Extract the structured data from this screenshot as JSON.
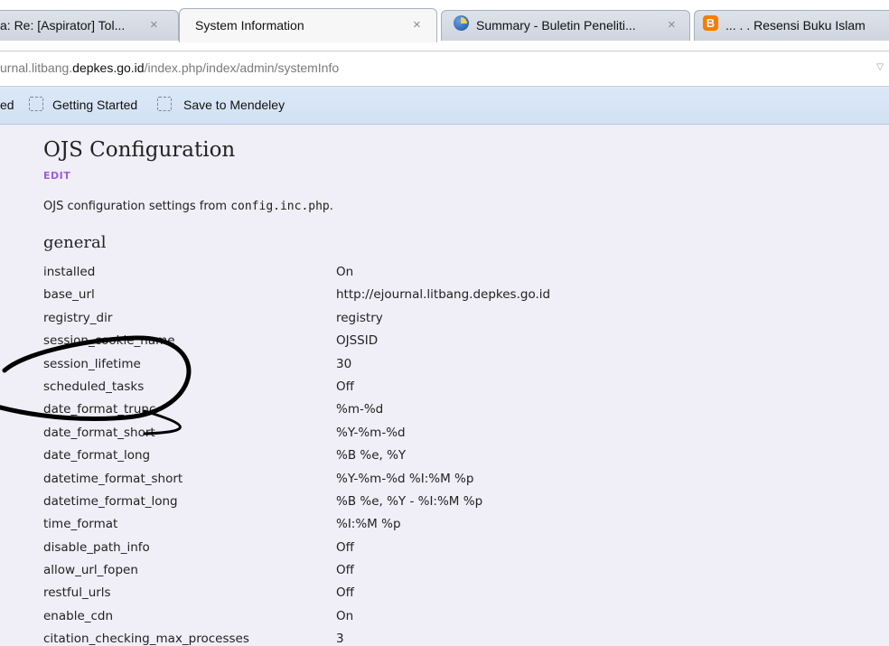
{
  "browser": {
    "tabs": [
      {
        "label": "a: Re: [Aspirator] Tol...",
        "active": false,
        "icon": "none"
      },
      {
        "label": "System Information",
        "active": true,
        "icon": "none"
      },
      {
        "label": "Summary - Buletin Peneliti...",
        "active": false,
        "icon": "report-icon"
      },
      {
        "label": "... . . Resensi Buku Islam",
        "active": false,
        "icon": "blogger-icon"
      }
    ],
    "tab_close_glyph": "×",
    "url": {
      "prefix": "urnal.litbang.",
      "host": "depkes.go.id",
      "path": "/index.php/index/admin/systemInfo"
    },
    "bookmarks": [
      {
        "label": "ed"
      },
      {
        "label": "Getting Started"
      },
      {
        "label": "Save to Mendeley"
      }
    ]
  },
  "page": {
    "title": "OJS Configuration",
    "edit_link": "EDIT",
    "description_prefix": "OJS configuration settings from ",
    "description_file": "config.inc.php",
    "description_suffix": ".",
    "section": "general",
    "settings": [
      {
        "key": "installed",
        "value": "On"
      },
      {
        "key": "base_url",
        "value": "http://ejournal.litbang.depkes.go.id"
      },
      {
        "key": "registry_dir",
        "value": "registry"
      },
      {
        "key": "session_cookie_name",
        "value": "OJSSID"
      },
      {
        "key": "session_lifetime",
        "value": "30"
      },
      {
        "key": "scheduled_tasks",
        "value": "Off"
      },
      {
        "key": "date_format_trunc",
        "value": "%m-%d"
      },
      {
        "key": "date_format_short",
        "value": "%Y-%m-%d"
      },
      {
        "key": "date_format_long",
        "value": "%B %e, %Y"
      },
      {
        "key": "datetime_format_short",
        "value": "%Y-%m-%d %I:%M %p"
      },
      {
        "key": "datetime_format_long",
        "value": "%B %e, %Y - %I:%M %p"
      },
      {
        "key": "time_format",
        "value": "%I:%M %p"
      },
      {
        "key": "disable_path_info",
        "value": "Off"
      },
      {
        "key": "allow_url_fopen",
        "value": "Off"
      },
      {
        "key": "restful_urls",
        "value": "Off"
      },
      {
        "key": "enable_cdn",
        "value": "On"
      },
      {
        "key": "citation_checking_max_processes",
        "value": "3"
      }
    ]
  },
  "colors": {
    "content_background": "#f0eef6",
    "bookmarks_bar": "#d6e4f5",
    "edit_link": "#9a5fe0",
    "annotation_ink": "#000000"
  }
}
